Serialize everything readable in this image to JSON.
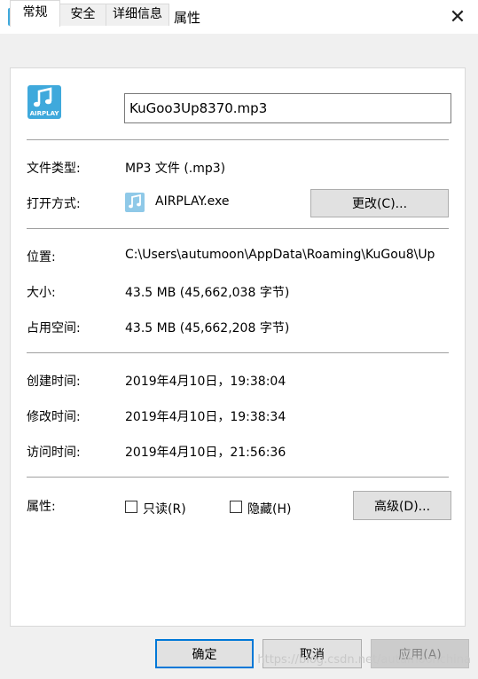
{
  "window": {
    "title": "KuGoo3Up8370.mp3 属性",
    "title_icon": "music-note-icon",
    "close_glyph": "✕"
  },
  "tabs": [
    {
      "label": "常规",
      "active": true
    },
    {
      "label": "安全",
      "active": false
    },
    {
      "label": "详细信息",
      "active": false
    }
  ],
  "general": {
    "file_icon": "airplay-music-icon",
    "file_icon_text": "AIRPLAY",
    "filename": "KuGoo3Up8370.mp3",
    "file_type_label": "文件类型:",
    "file_type_value": "MP3 文件 (.mp3)",
    "open_with_label": "打开方式:",
    "open_with_value": "AIRPLAY.exe",
    "change_button": "更改(C)...",
    "location_label": "位置:",
    "location_value": "C:\\Users\\autumoon\\AppData\\Roaming\\KuGou8\\Up",
    "size_label": "大小:",
    "size_value": "43.5 MB (45,662,038 字节)",
    "size_on_disk_label": "占用空间:",
    "size_on_disk_value": "43.5 MB (45,662,208 字节)",
    "created_label": "创建时间:",
    "created_value": "2019年4月10日，19:38:04",
    "modified_label": "修改时间:",
    "modified_value": "2019年4月10日，19:38:34",
    "accessed_label": "访问时间:",
    "accessed_value": "2019年4月10日，21:56:36",
    "attributes_label": "属性:",
    "readonly_label": "只读(R)",
    "readonly_checked": false,
    "hidden_label": "隐藏(H)",
    "hidden_checked": false,
    "advanced_button": "高级(D)..."
  },
  "footer": {
    "ok_button": "确定",
    "cancel_button": "取消",
    "apply_button": "应用(A)"
  },
  "watermark": "https://blog.csdn.net/autumoonchina",
  "colors": {
    "accent": "#0078d7",
    "icon_blue": "#3fa9dc"
  }
}
